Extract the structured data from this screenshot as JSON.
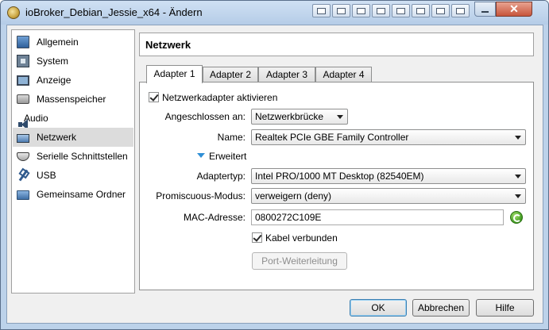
{
  "window": {
    "title": "ioBroker_Debian_Jessie_x64 - Ändern",
    "close_glyph": "✕"
  },
  "sidebar": {
    "items": [
      {
        "label": "Allgemein",
        "icon": "general-icon"
      },
      {
        "label": "System",
        "icon": "chip-icon"
      },
      {
        "label": "Anzeige",
        "icon": "display-icon"
      },
      {
        "label": "Massenspeicher",
        "icon": "storage-icon"
      },
      {
        "label": "Audio",
        "icon": "speaker-icon"
      },
      {
        "label": "Netzwerk",
        "icon": "network-icon",
        "selected": true
      },
      {
        "label": "Serielle Schnittstellen",
        "icon": "serial-port-icon"
      },
      {
        "label": "USB",
        "icon": "usb-icon"
      },
      {
        "label": "Gemeinsame Ordner",
        "icon": "shared-folder-icon"
      }
    ]
  },
  "page": {
    "title": "Netzwerk"
  },
  "tabs": [
    {
      "label": "Adapter 1",
      "active": true
    },
    {
      "label": "Adapter 2"
    },
    {
      "label": "Adapter 3"
    },
    {
      "label": "Adapter 4"
    }
  ],
  "adapter": {
    "enable_label": "Netzwerkadapter aktivieren",
    "enable_checked": true,
    "attached_label": "Angeschlossen an:",
    "attached_value": "Netzwerkbrücke",
    "name_label": "Name:",
    "name_value": "Realtek PCIe GBE Family Controller",
    "advanced_label": "Erweitert",
    "type_label": "Adaptertyp:",
    "type_value": "Intel PRO/1000 MT Desktop (82540EM)",
    "promisc_label": "Promiscuous-Modus:",
    "promisc_value": "verweigern (deny)",
    "mac_label": "MAC-Adresse:",
    "mac_value": "0800272C109E",
    "cable_label": "Kabel verbunden",
    "cable_checked": true,
    "port_forwarding_label": "Port-Weiterleitung"
  },
  "buttons": {
    "ok": "OK",
    "cancel": "Abbrechen",
    "help": "Hilfe"
  }
}
